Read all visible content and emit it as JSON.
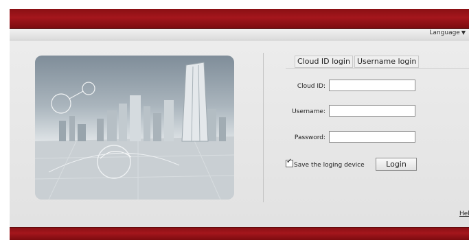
{
  "header": {
    "language_label": "Language",
    "language_caret": "▼"
  },
  "login": {
    "tabs": [
      {
        "label": "Cloud ID login"
      },
      {
        "label": "Username login"
      }
    ],
    "fields": {
      "cloud_id": {
        "label": "Cloud ID:",
        "value": ""
      },
      "username": {
        "label": "Username:",
        "value": ""
      },
      "password": {
        "label": "Password:",
        "value": ""
      }
    },
    "save_label": "Save the loging device",
    "save_checked": true,
    "login_button": "Login"
  },
  "footer": {
    "help_label": "Hel"
  },
  "colors": {
    "brand": "#a4161c",
    "background": "#e6e6e6"
  }
}
